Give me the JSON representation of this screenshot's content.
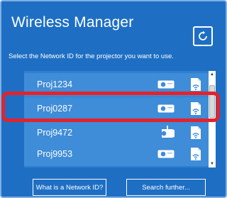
{
  "window": {
    "title": "Wireless Manager"
  },
  "header": {
    "instruction": "Select the Network ID for the projector you want to use.",
    "refresh_icon": "refresh-icon"
  },
  "list": {
    "items": [
      {
        "label": "Proj1234",
        "device_icon": "projector-icon",
        "network_icon": "network-icon",
        "selected": false
      },
      {
        "label": "Proj0287",
        "device_icon": "projector-icon",
        "network_icon": "network-icon",
        "selected": true
      },
      {
        "label": "Proj9472",
        "device_icon": "projector-ceiling-icon",
        "network_icon": "network-icon",
        "selected": false
      },
      {
        "label": "Proj9953",
        "device_icon": "projector-icon",
        "network_icon": "network-icon",
        "selected": false
      }
    ]
  },
  "footer": {
    "what_is_label": "What is a Network ID?",
    "search_label": "Search further..."
  },
  "colors": {
    "window_bg": "#1e6fc4",
    "row_bg": "#3f8cd8",
    "highlight": "#e3232c"
  }
}
